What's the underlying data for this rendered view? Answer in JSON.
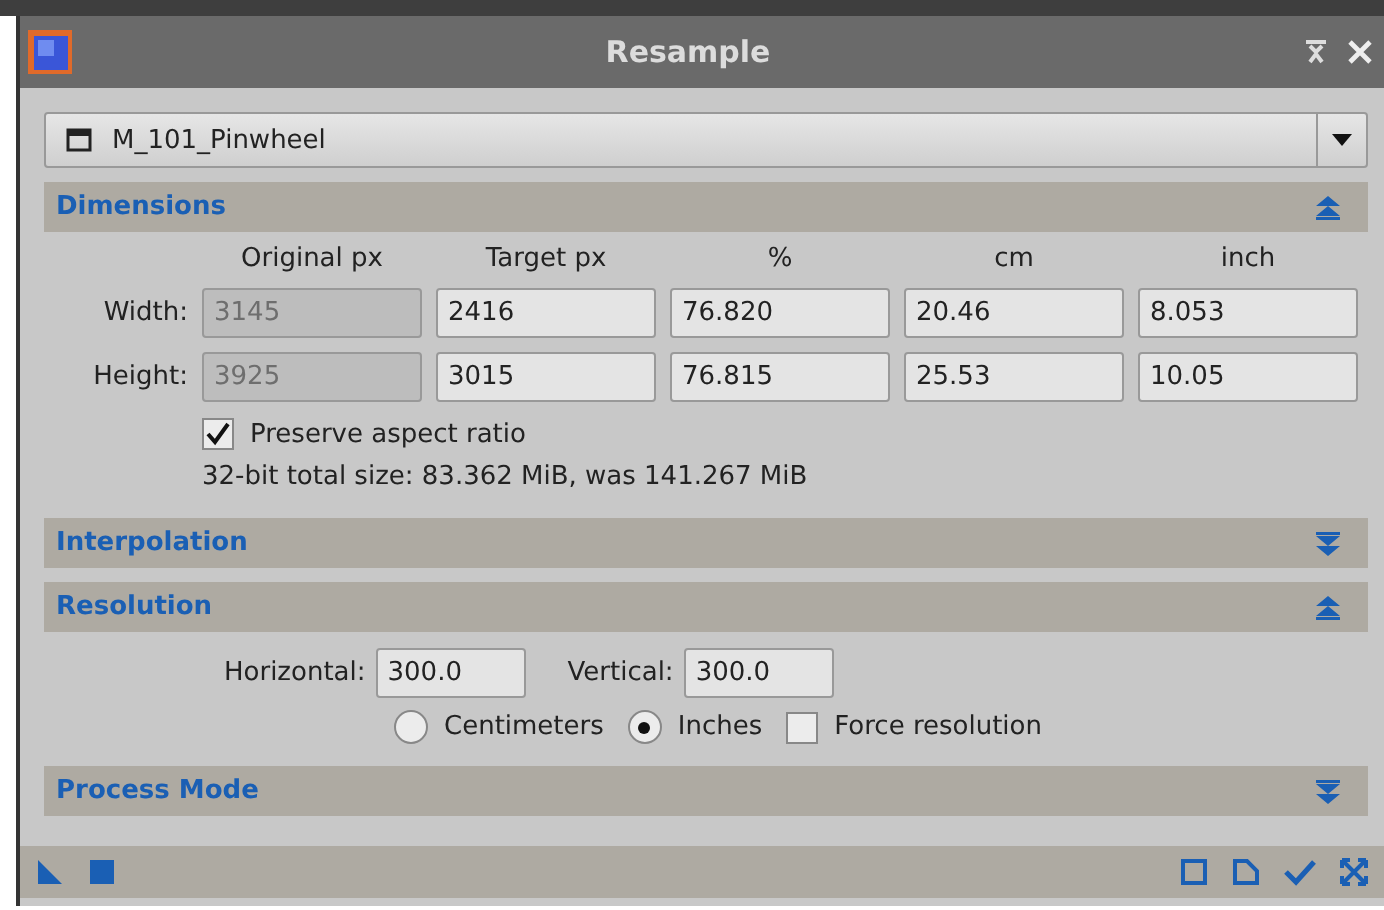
{
  "window": {
    "title": "Resample"
  },
  "view_selector": {
    "value": "M_101_Pinwheel"
  },
  "sections": [
    {
      "kind": "dimensions",
      "title": "Dimensions",
      "expanded": true,
      "columns": [
        "Original px",
        "Target px",
        "%",
        "cm",
        "inch"
      ],
      "rows": [
        {
          "label": "Width:",
          "original": "3145",
          "values": [
            "2416",
            "76.820",
            "20.46",
            "8.053"
          ]
        },
        {
          "label": "Height:",
          "original": "3925",
          "values": [
            "3015",
            "76.815",
            "25.53",
            "10.05"
          ]
        }
      ],
      "preserve_aspect": {
        "label": "Preserve aspect ratio",
        "checked": true
      },
      "info": "32-bit total size: 83.362 MiB, was 141.267 MiB"
    },
    {
      "title": "Interpolation",
      "expanded": false
    },
    {
      "kind": "resolution",
      "title": "Resolution",
      "expanded": true,
      "horizontal": {
        "label": "Horizontal:",
        "value": "300.0"
      },
      "vertical": {
        "label": "Vertical:",
        "value": "300.0"
      },
      "units": [
        {
          "label": "Centimeters",
          "selected": false
        },
        {
          "label": "Inches",
          "selected": true
        }
      ],
      "force": {
        "label": "Force resolution",
        "checked": false
      }
    },
    {
      "title": "Process Mode",
      "expanded": false
    }
  ]
}
